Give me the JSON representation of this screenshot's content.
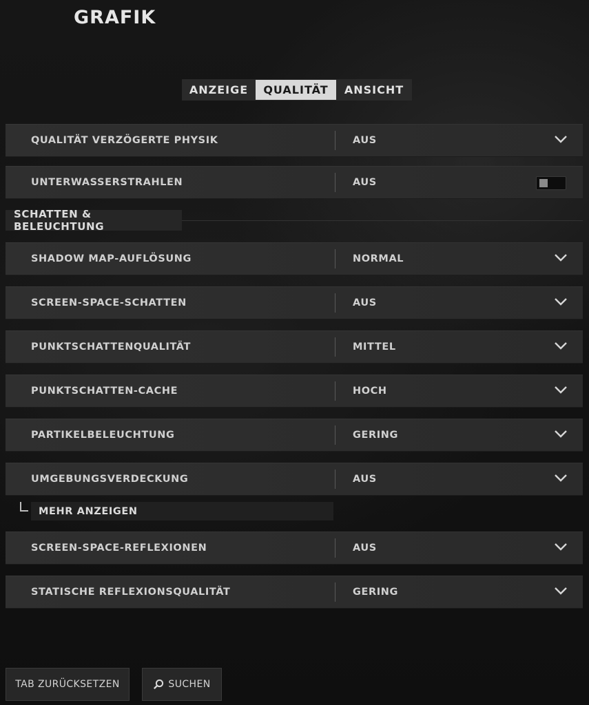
{
  "page": {
    "title": "GRAFIK"
  },
  "tabs": [
    {
      "label": "ANZEIGE"
    },
    {
      "label": "QUALITÄT"
    },
    {
      "label": "ANSICHT"
    }
  ],
  "settings": [
    {
      "label": "QUALITÄT VERZÖGERTE PHYSIK",
      "value": "AUS",
      "control": "chevron-down-icon"
    },
    {
      "label": "UNTERWASSERSTRAHLEN",
      "value": "AUS",
      "control": "toggle"
    }
  ],
  "section": {
    "title": "SCHATTEN & BELEUCHTUNG",
    "items": [
      {
        "label": "SHADOW MAP-AUFLÖSUNG",
        "value": "NORMAL"
      },
      {
        "label": "SCREEN-SPACE-SCHATTEN",
        "value": "AUS"
      },
      {
        "label": "PUNKTSCHATTENQUALITÄT",
        "value": "MITTEL"
      },
      {
        "label": "PUNKTSCHATTEN-CACHE",
        "value": "HOCH"
      },
      {
        "label": "PARTIKELBELEUCHTUNG",
        "value": "GERING"
      },
      {
        "label": "UMGEBUNGSVERDECKUNG",
        "value": "AUS"
      }
    ],
    "show_more": "MEHR ANZEIGEN",
    "items_after": [
      {
        "label": "SCREEN-SPACE-REFLEXIONEN",
        "value": "AUS"
      },
      {
        "label": "STATISCHE REFLEXIONSQUALITÄT",
        "value": "GERING"
      }
    ]
  },
  "footer": {
    "reset_label": "TAB ZURÜCKSETZEN",
    "search_label": "SUCHEN"
  }
}
